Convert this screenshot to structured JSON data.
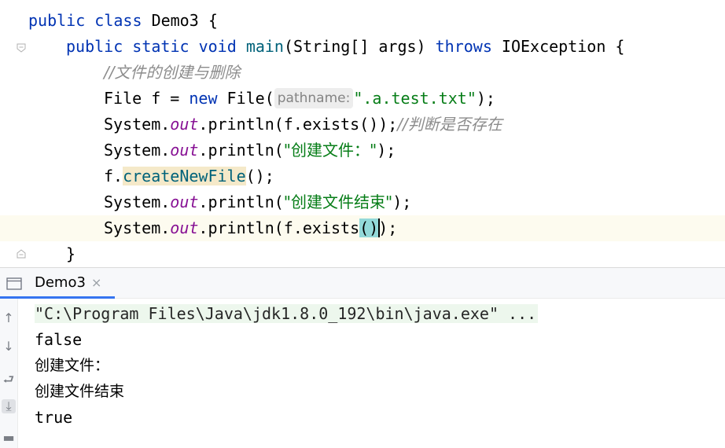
{
  "editor": {
    "line1": {
      "kw1": "public",
      "kw2": "class",
      "name": "Demo3",
      "brace": " {"
    },
    "line2": {
      "kw1": "public",
      "kw2": "static",
      "kw3": "void",
      "method": "main",
      "params": "(String[] args) ",
      "throws": "throws",
      "exc": " IOException {"
    },
    "line3": {
      "comment": "//文件的创建与删除"
    },
    "line4": {
      "type": "File f = ",
      "kw": "new",
      "call": " File(",
      "hint": "pathname:",
      "str": "\".a.test.txt\"",
      "end": ");"
    },
    "line5": {
      "sys": "System.",
      "out": "out",
      "call": ".println(f.exists());",
      "comment": "//判断是否存在"
    },
    "line6": {
      "sys": "System.",
      "out": "out",
      "call": ".println(",
      "str": "\"创建文件：\"",
      "end": ");"
    },
    "line7": {
      "obj": "f.",
      "method": "createNewFile",
      "end": "();"
    },
    "line8": {
      "sys": "System.",
      "out": "out",
      "call": ".println(",
      "str": "\"创建文件结束\"",
      "end": ");"
    },
    "line9": {
      "sys": "System.",
      "out": "out",
      "call": ".println(f.exists",
      "paren": "()",
      "end": ");"
    },
    "line10": {
      "brace": "}"
    }
  },
  "run_panel": {
    "tab_label": "Demo3",
    "tab_close": "×",
    "toolbar": {
      "up": "↑",
      "down": "↓",
      "wrap": "⮐",
      "scroll_end": "⤓",
      "print": "▬"
    }
  },
  "console": {
    "command": "\"C:\\Program Files\\Java\\jdk1.8.0_192\\bin\\java.exe\" ...",
    "lines": [
      "false",
      "创建文件：",
      "创建文件结束",
      "true"
    ]
  },
  "colors": {
    "keyword": "#0033b3",
    "string": "#067d17",
    "comment": "#8c8c8c",
    "field": "#871094",
    "tab_accent": "#3574f0"
  }
}
